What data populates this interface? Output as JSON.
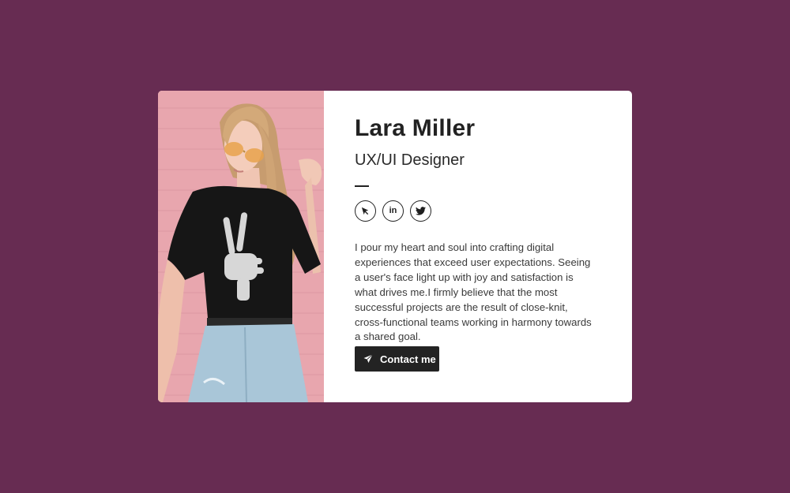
{
  "profile": {
    "name": "Lara Miller",
    "role": "UX/UI Designer",
    "photo_alt": "Lara Miller",
    "bio": "I pour my heart and soul into crafting digital experiences that exceed user expectations. Seeing a user's face light up with joy and satisfaction is what drives me.I firmly believe that the most successful projects are the result of close-knit, cross-functional teams working in harmony towards a shared goal."
  },
  "socials": [
    {
      "icon": "cursor-icon"
    },
    {
      "icon": "linkedin-icon",
      "glyph": "in"
    },
    {
      "icon": "twitter-icon"
    }
  ],
  "cta": {
    "label": "Contact me",
    "icon": "send-icon"
  },
  "colors": {
    "page_background": "#672c52",
    "card_background": "#ffffff",
    "text_primary": "#222222",
    "button_background": "#232323",
    "button_text": "#ffffff"
  }
}
